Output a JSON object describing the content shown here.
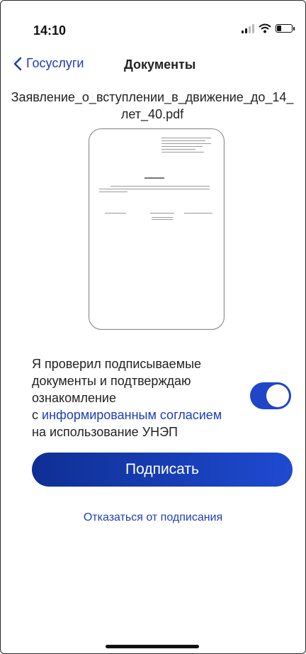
{
  "status_bar": {
    "time": "14:10",
    "battery_level": 0.3
  },
  "nav": {
    "back_label": "Госуслуги",
    "title": "Документы"
  },
  "document": {
    "filename": "Заявление_о_вступлении_в_движение_до_14_лет_40.pdf"
  },
  "consent": {
    "text_part1": "Я проверил подписываемые документы и подтверждаю ознакомление",
    "text_part2_prefix": "с ",
    "link_text": "информированным согласием",
    "text_part3": "на использование УНЭП",
    "toggle_on": true
  },
  "actions": {
    "sign_label": "Подписать",
    "decline_label": "Отказаться от подписания"
  },
  "colors": {
    "accent": "#1d3fb8",
    "button_start": "#0e2f93",
    "button_end": "#1f4ad1"
  }
}
